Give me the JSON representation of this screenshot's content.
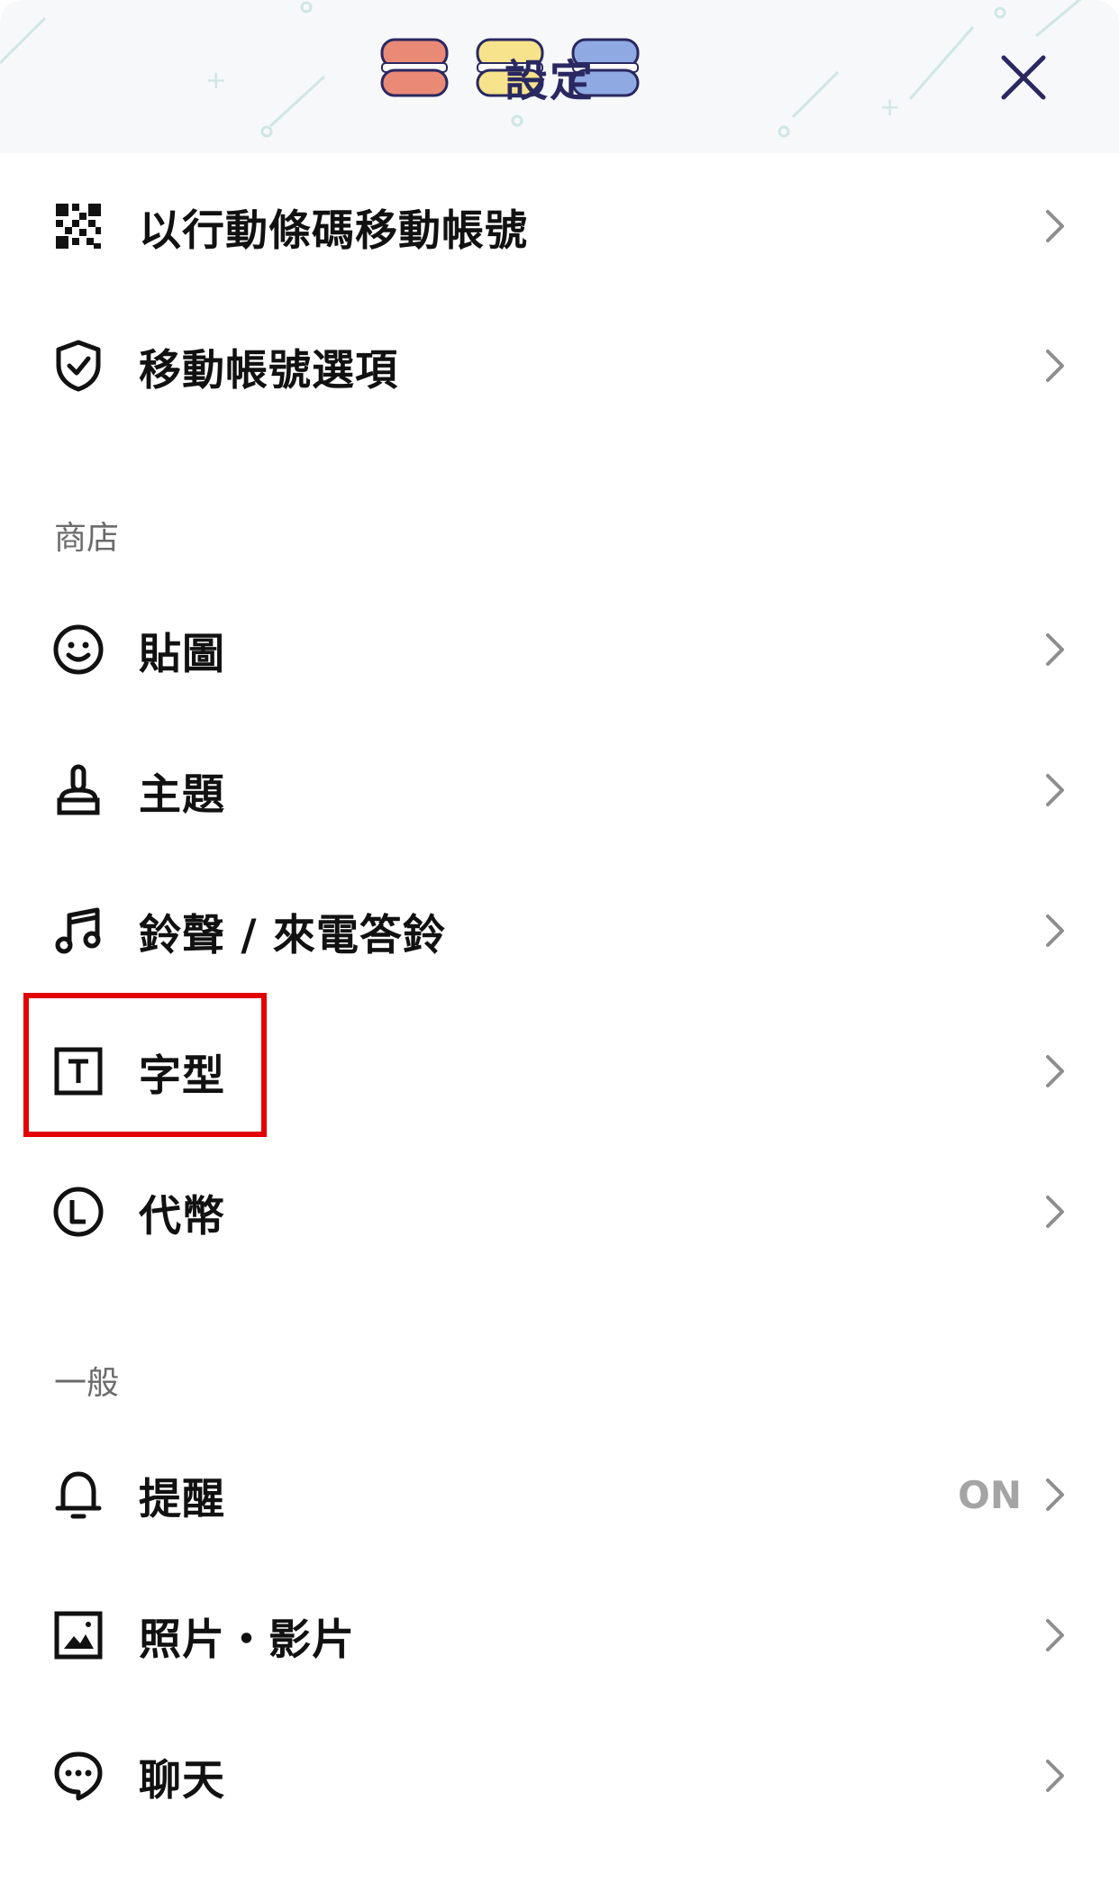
{
  "header": {
    "title": "設定"
  },
  "rows_top": [
    {
      "label": "以行動條碼移動帳號",
      "icon": "qr-code-icon"
    },
    {
      "label": "移動帳號選項",
      "icon": "shield-icon"
    }
  ],
  "sections": {
    "store": {
      "header": "商店"
    },
    "general": {
      "header": "一般"
    }
  },
  "store_items": [
    {
      "label": "貼圖",
      "icon": "smiley-icon"
    },
    {
      "label": "主題",
      "icon": "brush-icon"
    },
    {
      "label": "鈴聲 / 來電答鈴",
      "icon": "music-note-icon"
    },
    {
      "label": "字型",
      "icon": "text-font-icon"
    },
    {
      "label": "代幣",
      "icon": "coin-icon"
    }
  ],
  "general_items": [
    {
      "label": "提醒",
      "icon": "bell-icon",
      "value": "ON"
    },
    {
      "label": "照片・影片",
      "icon": "image-icon"
    },
    {
      "label": "聊天",
      "icon": "chat-bubble-icon"
    }
  ],
  "colors": {
    "header_bg": "#f6f8fa",
    "title": "#2a2860",
    "highlight": "#e30000",
    "value_text": "#a4a4a4",
    "section_text": "#6b6b6b"
  }
}
